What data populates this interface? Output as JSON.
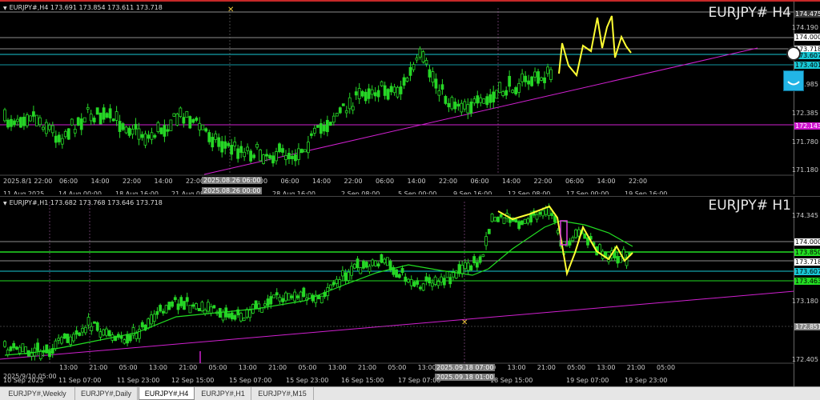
{
  "top_chart": {
    "info": "EURJPY#,H4  173.691 173.854 173.611 173.718",
    "title": "EURJPY# H4",
    "price_labels": [
      {
        "text": "174.475",
        "color": "#c8c8c8",
        "bg": "#3a3a3a",
        "fg": "#ffffff"
      },
      {
        "text": "174.190"
      },
      {
        "text": "174.000",
        "bg": "#ffffff",
        "fg": "#000000"
      },
      {
        "text": "173.718",
        "bg": "#ffffff",
        "fg": "#000000"
      },
      {
        "text": "173.607",
        "bg": "#18c7d4",
        "fg": "#000000"
      },
      {
        "text": "173.401",
        "bg": "#18c7d4",
        "fg": "#000000"
      },
      {
        "text": "172.985"
      },
      {
        "text": "172.385"
      },
      {
        "text": "172.143",
        "bg": "#d017d0",
        "fg": "#ffffff"
      },
      {
        "text": "171.780"
      },
      {
        "text": "171.180"
      }
    ],
    "time_labels": [
      "2025.8/1 22:00",
      "11 Aug 2025",
      "14 Aug 00:00",
      "18 Aug 16:00",
      "21 Aug 08:00",
      "28 Aug 16:00",
      "2 Sep 08:00",
      "5 Sep 00:00",
      "9 Sep 16:00",
      "12 Sep 08:00",
      "17 Sep 00:00",
      "19 Sep 16:00"
    ],
    "axis_hours": [
      "06:00",
      "14:00",
      "22:00",
      "14:00",
      "22:00",
      "14:00",
      "22:00",
      "06:00",
      "14:00",
      "22:00",
      "06:00",
      "14:00",
      "22:00",
      "06:00",
      "14:00",
      "22:00",
      "06:00",
      "14:00",
      "22:00"
    ],
    "crosshair_time": "2025.08.26 06:00",
    "crosshair_time_2": "2025.08.26 00:00"
  },
  "bottom_chart": {
    "info": "EURJPY#,H1  173.682 173.768 173.646 173.718",
    "title": "EURJPY# H1",
    "price_labels": [
      {
        "text": "174.345"
      },
      {
        "text": "174.000",
        "bg": "#ffffff",
        "fg": "#000000"
      },
      {
        "text": "173.850",
        "bg": "#22dd22",
        "fg": "#000000"
      },
      {
        "text": "173.718",
        "bg": "#ffffff",
        "fg": "#000000"
      },
      {
        "text": "173.607",
        "bg": "#18c7d4",
        "fg": "#000000"
      },
      {
        "text": "173.463",
        "bg": "#22dd22",
        "fg": "#000000"
      },
      {
        "text": "173.180"
      },
      {
        "text": "172.851",
        "bg": "#888888",
        "fg": "#ffffff"
      },
      {
        "text": "172.405"
      }
    ],
    "time_labels": [
      "2025/9/10 05:00",
      "10 Sep 2025",
      "11 Sep 07:00",
      "11 Sep 23:00",
      "12 Sep 15:00",
      "15 Sep 07:00",
      "15 Sep 23:00",
      "16 Sep 15:00",
      "17 Sep 07:00",
      "18 Sep 15:00",
      "19 Sep 07:00",
      "19 Sep 23:00"
    ],
    "axis_hours": [
      "13:00",
      "21:00",
      "05:00",
      "13:00",
      "21:00",
      "05:00",
      "13:00",
      "21:00",
      "05:00",
      "13:00",
      "21:00",
      "05:00",
      "13:00",
      "21:00",
      "05:00",
      "13:00",
      "21:00",
      "05:00",
      "13:00",
      "21:00",
      "05:00"
    ],
    "crosshair_time": "2025.09.18 07:00",
    "crosshair_time_2": "2025.09.18 01:00"
  },
  "tabs": [
    "EURJPY#,Weekly",
    "EURJPY#,Daily",
    "EURJPY#,H4",
    "EURJPY#,H1",
    "EURJPY#,M15"
  ],
  "active_tab": "EURJPY#,H4",
  "colors": {
    "bull_candle": "#26d626",
    "trend": "#d020d0",
    "support": "#18c7d4",
    "zigzag": "#ffff33",
    "ma": "#22dd22",
    "level": "#bdbdbd"
  },
  "icons": {
    "pen": "pen-icon",
    "side": "face-icon"
  }
}
